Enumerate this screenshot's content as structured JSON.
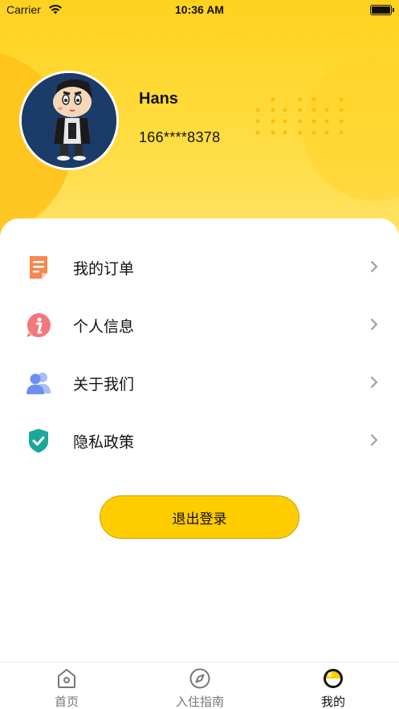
{
  "status_bar": {
    "carrier": "Carrier",
    "time": "10:36 AM"
  },
  "profile": {
    "name": "Hans",
    "phone": "166****8378"
  },
  "menu": [
    {
      "label": "我的订单",
      "icon": "order-icon",
      "color": "#f5874f"
    },
    {
      "label": "个人信息",
      "icon": "info-icon",
      "color": "#f2787a"
    },
    {
      "label": "关于我们",
      "icon": "users-icon",
      "color": "#6b8ff2"
    },
    {
      "label": "隐私政策",
      "icon": "shield-check-icon",
      "color": "#1aa89a"
    }
  ],
  "logout_label": "退出登录",
  "tabs": [
    {
      "label": "首页",
      "icon": "home-icon",
      "active": false
    },
    {
      "label": "入住指南",
      "icon": "compass-icon",
      "active": false
    },
    {
      "label": "我的",
      "icon": "profile-icon",
      "active": true
    }
  ],
  "colors": {
    "accent": "#ffcc00",
    "header": "#ffd21f"
  }
}
